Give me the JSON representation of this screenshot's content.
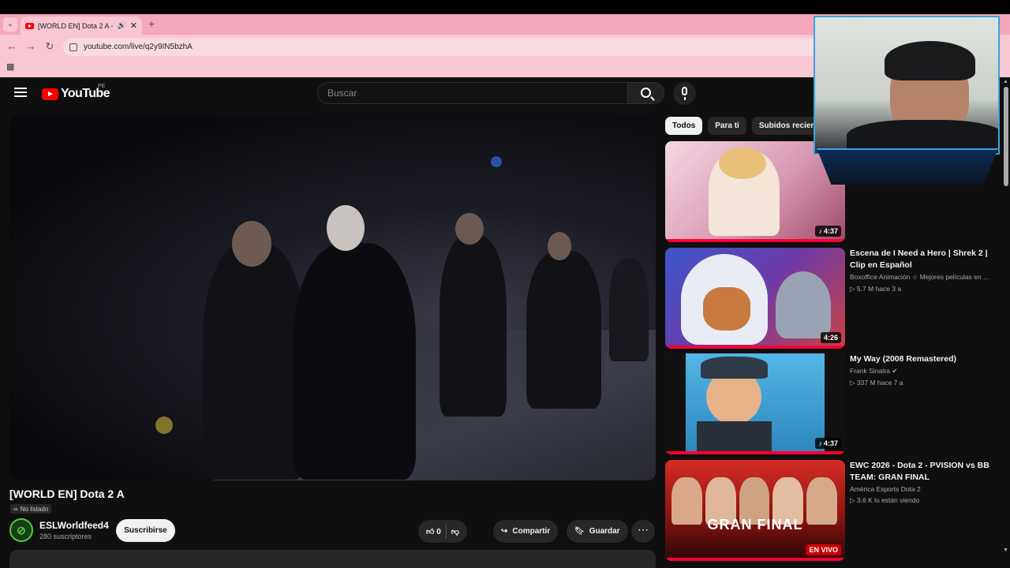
{
  "browser": {
    "tab_title": "[WORLD EN] Dota 2 A - You",
    "url": "youtube.com/live/q2y9IN5bzhA"
  },
  "header": {
    "logo_text": "YouTube",
    "country_code": "PE",
    "search_placeholder": "Buscar"
  },
  "video": {
    "title": "[WORLD EN] Dota 2 A",
    "visibility": "No listado",
    "channel_name": "ESLWorldfeed4",
    "subscribers": "280 suscriptores",
    "subscribe_label": "Suscribirse",
    "likes": "0",
    "share_label": "Compartir",
    "save_label": "Guardar"
  },
  "chips": [
    "Todos",
    "Para ti",
    "Subidos recientes"
  ],
  "recommendations": [
    {
      "title": "",
      "channel": "",
      "meta": "",
      "duration": "4:37",
      "thumb_colors": [
        "#f0c8d8",
        "#c98ea6"
      ]
    },
    {
      "title": "Escena de I Need a Hero | Shrek 2 | Clip en Español",
      "channel": "Boxoffice Animación ☆ Mejores películas en ...",
      "meta": "▷ 5.7 M   hace 3 a",
      "duration": "4:26",
      "thumb_colors": [
        "#3b56c9",
        "#c94242"
      ]
    },
    {
      "title": "My Way (2008 Remastered)",
      "channel": "Frank Sinatra",
      "meta": "▷ 337 M   hace 7 a",
      "duration": "4:37",
      "thumb_colors": [
        "#3fa3d6",
        "#1f5f8e"
      ]
    },
    {
      "title": "EWC 2026 - Dota 2 -  PVISION vs BB TEAM: GRAN FINAL",
      "channel": "América Esports Dota 2",
      "meta": "▷ 3.6 K lo están viendo",
      "duration": "EN VIVO",
      "thumb_text": "GRAN FINAL",
      "thumb_colors": [
        "#c9201e",
        "#3b0a0a"
      ]
    }
  ],
  "colors": {
    "accent_red": "#ff0033",
    "background": "#0f0f0f",
    "browser_tab": "#f4a7bb"
  }
}
